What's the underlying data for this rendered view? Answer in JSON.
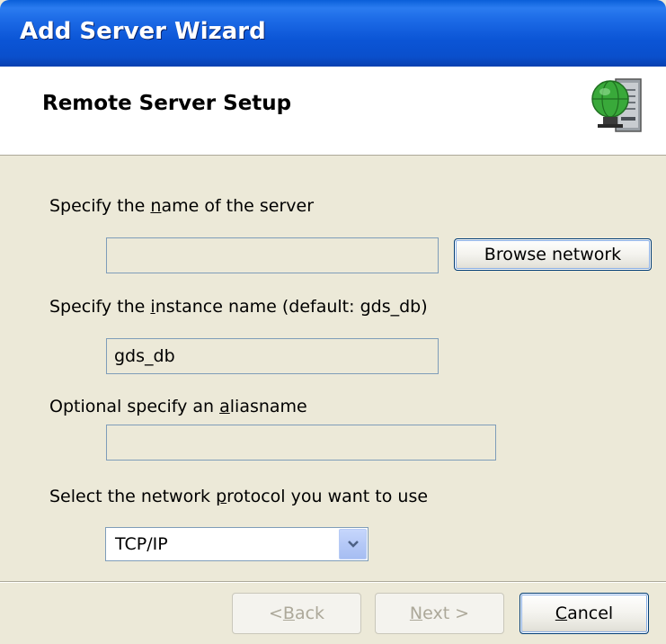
{
  "window": {
    "title": "Add Server Wizard"
  },
  "header": {
    "title": "Remote Server Setup",
    "icon": "server-globe-icon"
  },
  "server_name": {
    "label_pre": "Specify the ",
    "label_u": "n",
    "label_post": "ame of the server",
    "value": "",
    "browse_label": "Browse network"
  },
  "instance": {
    "label_pre": "Specify the ",
    "label_u": "i",
    "label_post": "nstance name (default: gds_db)",
    "value": "gds_db"
  },
  "alias": {
    "label_pre": "Optional specify an ",
    "label_u": "a",
    "label_post": "liasname",
    "value": ""
  },
  "protocol": {
    "label_pre": "Select the network ",
    "label_u": "p",
    "label_post": "rotocol you want to use",
    "selected": "TCP/IP"
  },
  "buttons": {
    "back_pre": "< ",
    "back_u": "B",
    "back_post": "ack",
    "next_u": "N",
    "next_post": "ext >",
    "cancel_u": "C",
    "cancel_post": "ancel"
  }
}
